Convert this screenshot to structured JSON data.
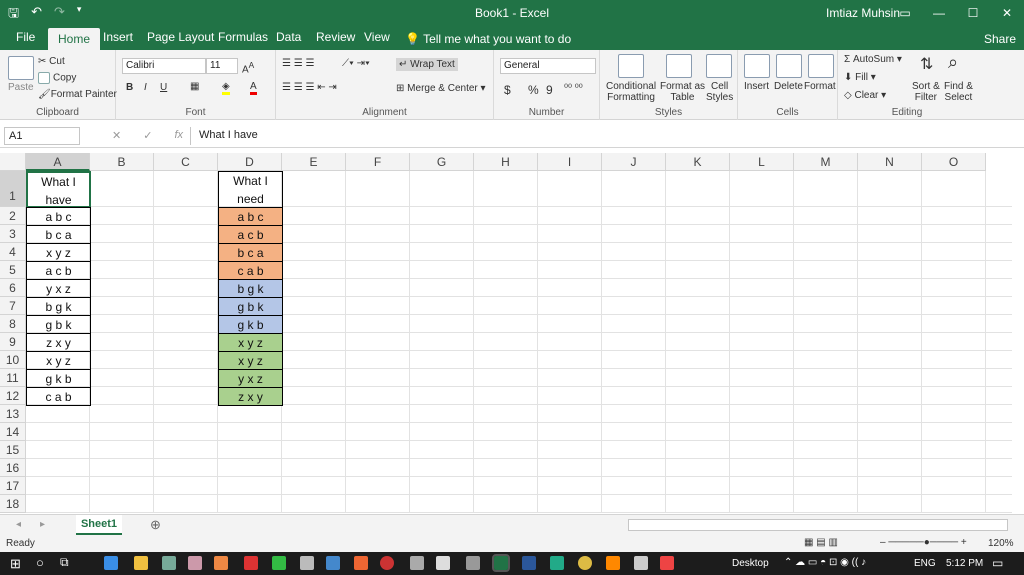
{
  "window": {
    "title": "Book1 - Excel",
    "user": "Imtiaz Muhsin"
  },
  "tabs": [
    "File",
    "Home",
    "Insert",
    "Page Layout",
    "Formulas",
    "Data",
    "Review",
    "View"
  ],
  "tell_me": "Tell me what you want to do",
  "share": "Share",
  "ribbon": {
    "clipboard": {
      "label": "Clipboard",
      "paste": "Paste",
      "cut": "Cut",
      "copy": "Copy",
      "format_painter": "Format Painter"
    },
    "font": {
      "label": "Font",
      "name": "Calibri",
      "size": "11",
      "bold": "B",
      "italic": "I",
      "underline": "U"
    },
    "alignment": {
      "label": "Alignment",
      "wrap_text": "Wrap Text",
      "merge_center": "Merge & Center"
    },
    "number": {
      "label": "Number",
      "format": "General",
      "currency": "$",
      "percent": "%",
      "comma": "9"
    },
    "styles": {
      "label": "Styles",
      "conditional": [
        "Conditional",
        "Formatting"
      ],
      "format_table": [
        "Format as",
        "Table"
      ],
      "cell_styles": [
        "Cell",
        "Styles"
      ]
    },
    "cells": {
      "label": "Cells",
      "insert": "Insert",
      "delete": "Delete",
      "format": "Format"
    },
    "editing": {
      "label": "Editing",
      "autosum": "AutoSum",
      "fill": "Fill",
      "clear": "Clear",
      "sort": [
        "Sort &",
        "Filter"
      ],
      "find": [
        "Find &",
        "Select"
      ]
    }
  },
  "formula_bar": {
    "name_box": "A1",
    "content": "What I have"
  },
  "columns": [
    "A",
    "B",
    "C",
    "D",
    "E",
    "F",
    "G",
    "H",
    "I",
    "J",
    "K",
    "L",
    "M",
    "N",
    "O"
  ],
  "rows": [
    "1",
    "2",
    "3",
    "4",
    "5",
    "6",
    "7",
    "8",
    "9",
    "10",
    "11",
    "12",
    "13",
    "14",
    "15",
    "16",
    "17",
    "18"
  ],
  "col_a": {
    "header": [
      "What I",
      "have"
    ],
    "values": [
      "a b c",
      "b c a",
      "x y z",
      "a c b",
      "y x z",
      "b g k",
      "g b k",
      "z x y",
      "x y z",
      "g k b",
      "c a b"
    ]
  },
  "col_d": {
    "header": [
      "What I",
      "need"
    ],
    "values": [
      "a b c",
      "a c b",
      "b c a",
      "c a b",
      "b g k",
      "g b k",
      "g k b",
      "x y z",
      "x y z",
      "y x z",
      "z x y"
    ],
    "fills": [
      "#f4b183",
      "#f4b183",
      "#f4b183",
      "#f4b183",
      "#b4c6e7",
      "#b4c6e7",
      "#b4c6e7",
      "#a9d08e",
      "#a9d08e",
      "#a9d08e",
      "#a9d08e"
    ]
  },
  "sheet_tab": "Sheet1",
  "status": {
    "ready": "Ready",
    "zoom": "120%"
  },
  "taskbar": {
    "desktop": "Desktop",
    "lang": "ENG",
    "time": "5:12 PM"
  },
  "colors": {
    "accent": "#217346"
  }
}
